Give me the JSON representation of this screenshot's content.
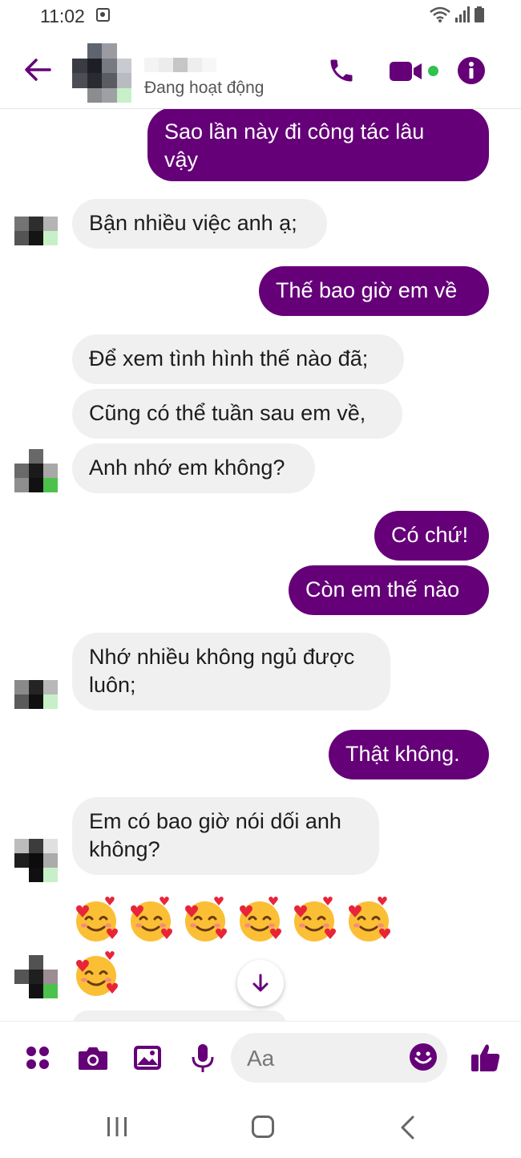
{
  "status_bar": {
    "time": "11:02"
  },
  "header": {
    "status": "Đang hoạt động"
  },
  "messages": [
    {
      "side": "out",
      "text": "Sao lần này đi công tác lâu\nvậy"
    },
    {
      "side": "in",
      "text": "Bận nhiều việc anh ạ;"
    },
    {
      "side": "out",
      "text": "Thế bao giờ em về"
    },
    {
      "side": "in",
      "text": "Để xem tình hình thế nào đã;"
    },
    {
      "side": "in",
      "text": "Cũng có thể tuần sau em về,"
    },
    {
      "side": "in",
      "text": "Anh nhớ em không?"
    },
    {
      "side": "out",
      "text": "Có chứ!"
    },
    {
      "side": "out",
      "text": "Còn em thế nào"
    },
    {
      "side": "in",
      "text": "Nhớ nhiều không ngủ được\nluôn;"
    },
    {
      "side": "out",
      "text": "Thật không."
    },
    {
      "side": "in",
      "text": "Em có bao giờ nói dối anh\nkhông?"
    }
  ],
  "emoji_reaction": {
    "name": "smiling-face-with-hearts",
    "count": 7
  },
  "composer": {
    "placeholder": "Aa"
  },
  "colors": {
    "accent": "#650078",
    "incoming_bubble": "#f0f0f0",
    "online_dot": "#31c24d"
  },
  "icons": [
    "back-arrow-icon",
    "phone-icon",
    "video-icon",
    "info-icon",
    "menu-dots-icon",
    "camera-icon",
    "image-icon",
    "microphone-icon",
    "emoji-icon",
    "thumbs-up-icon",
    "scroll-down-icon"
  ]
}
